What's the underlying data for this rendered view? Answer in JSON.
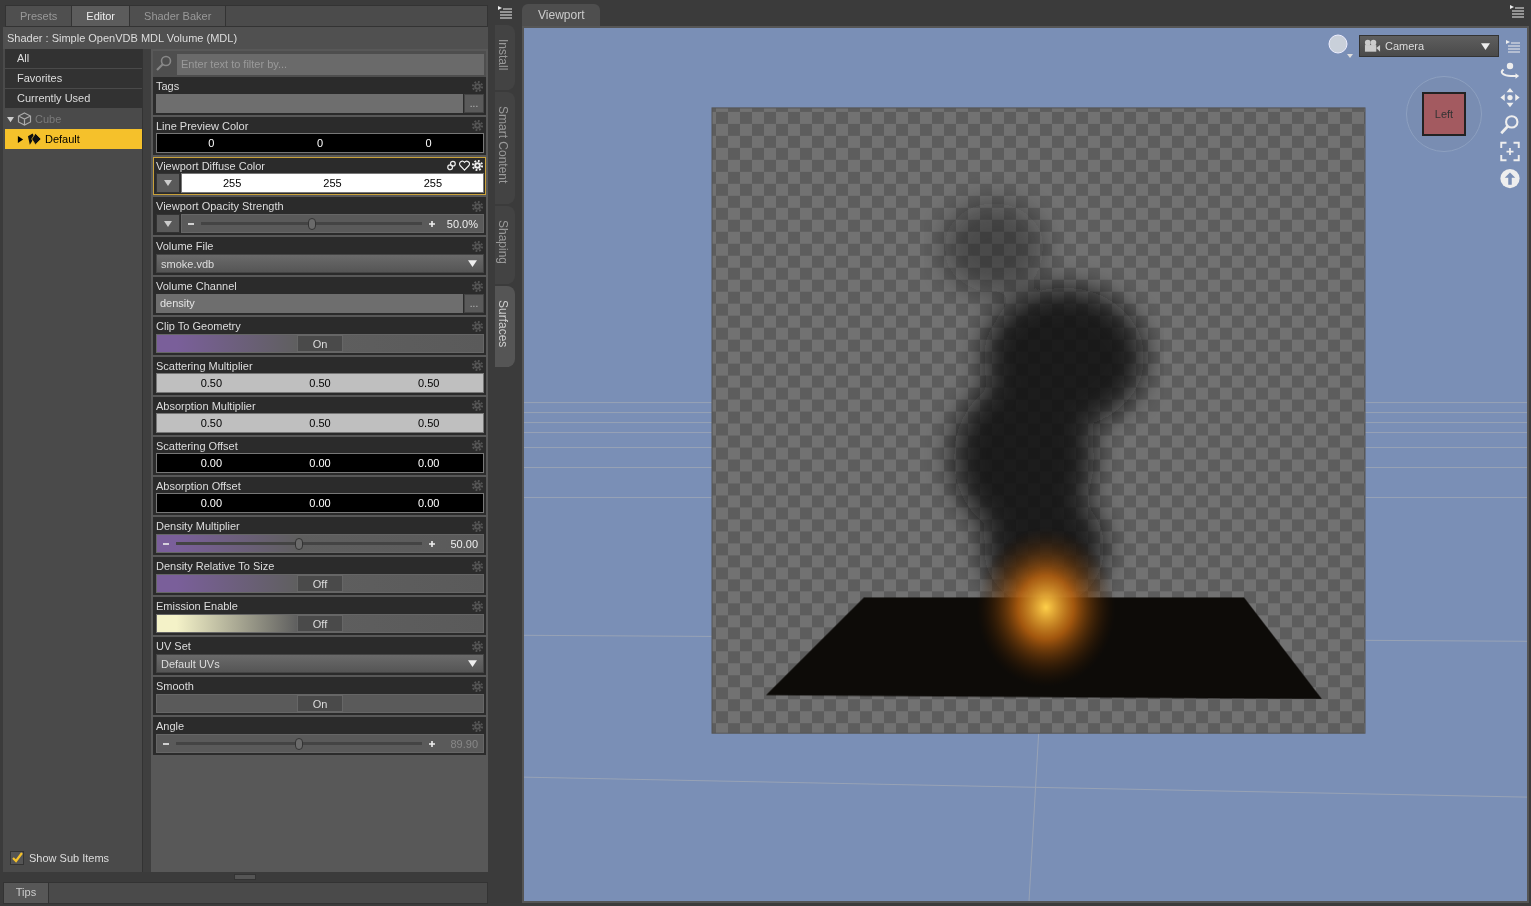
{
  "tabs": [
    {
      "label": "Presets",
      "selected": false
    },
    {
      "label": "Editor",
      "selected": true
    },
    {
      "label": "Shader Baker",
      "selected": false
    }
  ],
  "shader_title": "Shader : Simple OpenVDB MDL Volume (MDL)",
  "sidebar": {
    "items": [
      {
        "label": "All",
        "selected": false
      },
      {
        "label": "Favorites",
        "selected": false
      },
      {
        "label": "Currently Used",
        "selected": false
      }
    ],
    "tree": [
      {
        "label": "Cube",
        "expanded": true,
        "selected": false,
        "disabled": true,
        "children": [
          {
            "label": "Default",
            "expanded": false,
            "selected": true,
            "disabled": false
          }
        ]
      }
    ],
    "show_sub_items": {
      "label": "Show Sub Items",
      "checked": true
    }
  },
  "filter": {
    "placeholder": "Enter text to filter by..."
  },
  "properties": [
    {
      "kind": "text",
      "label": "Tags",
      "button": "...",
      "selected": false,
      "expander": false
    },
    {
      "kind": "color",
      "label": "Line Preview Color",
      "values": [
        "0",
        "0",
        "0"
      ],
      "color": "#000000",
      "selected": false,
      "expander": false
    },
    {
      "kind": "color",
      "label": "Viewport Diffuse Color",
      "values": [
        "255",
        "255",
        "255"
      ],
      "color": "#ffffff",
      "selected": true,
      "expander": true
    },
    {
      "kind": "slider",
      "label": "Viewport Opacity Strength",
      "level": 0.5,
      "reading": "50.0%",
      "selected": false,
      "expander": true,
      "disabled": false
    },
    {
      "kind": "dropdown",
      "label": "Volume File",
      "value": "smoke.vdb",
      "selected": false,
      "expander": false
    },
    {
      "kind": "text",
      "label": "Volume Channel",
      "value": "density",
      "button": "...",
      "selected": false,
      "expander": false
    },
    {
      "kind": "toggle",
      "label": "Clip To Geometry",
      "value": "On",
      "color": "#7a5f9a",
      "selected": false,
      "expander": false
    },
    {
      "kind": "color",
      "label": "Scattering Multiplier",
      "values": [
        "0.50",
        "0.50",
        "0.50"
      ],
      "color": "#bfbfbf",
      "selected": false,
      "expander": false
    },
    {
      "kind": "color",
      "label": "Absorption Multiplier",
      "values": [
        "0.50",
        "0.50",
        "0.50"
      ],
      "color": "#bfbfbf",
      "selected": false,
      "expander": false
    },
    {
      "kind": "color",
      "label": "Scattering Offset",
      "values": [
        "0.00",
        "0.00",
        "0.00"
      ],
      "color": "#000000",
      "selected": false,
      "expander": false
    },
    {
      "kind": "color",
      "label": "Absorption Offset",
      "values": [
        "0.00",
        "0.00",
        "0.00"
      ],
      "color": "#000000",
      "selected": false,
      "expander": false
    },
    {
      "kind": "slider",
      "label": "Density Multiplier",
      "level": 0.5,
      "reading": "50.00",
      "color": "#7a5f9a",
      "selected": false,
      "expander": false,
      "disabled": false
    },
    {
      "kind": "toggle",
      "label": "Density Relative To Size",
      "value": "Off",
      "color": "#7a5f9a",
      "selected": false,
      "expander": false
    },
    {
      "kind": "toggle",
      "label": "Emission Enable",
      "value": "Off",
      "color": "#f4f2c8",
      "selected": false,
      "expander": false
    },
    {
      "kind": "dropdown",
      "label": "UV Set",
      "value": "Default UVs",
      "selected": false,
      "expander": false
    },
    {
      "kind": "toggle",
      "label": "Smooth",
      "value": "On",
      "selected": false,
      "expander": false
    },
    {
      "kind": "slider",
      "label": "Angle",
      "level": 0.5,
      "reading": "89.90",
      "selected": false,
      "expander": false,
      "disabled": true
    }
  ],
  "side_tabs": [
    {
      "label": "Install",
      "selected": false
    },
    {
      "label": "Smart Content",
      "selected": false
    },
    {
      "label": "Shaping",
      "selected": false
    },
    {
      "label": "Surfaces",
      "selected": true
    }
  ],
  "bottom_tab": "Tips",
  "viewport": {
    "tab": "Viewport",
    "camera": "Camera",
    "cube_face": "Left"
  }
}
